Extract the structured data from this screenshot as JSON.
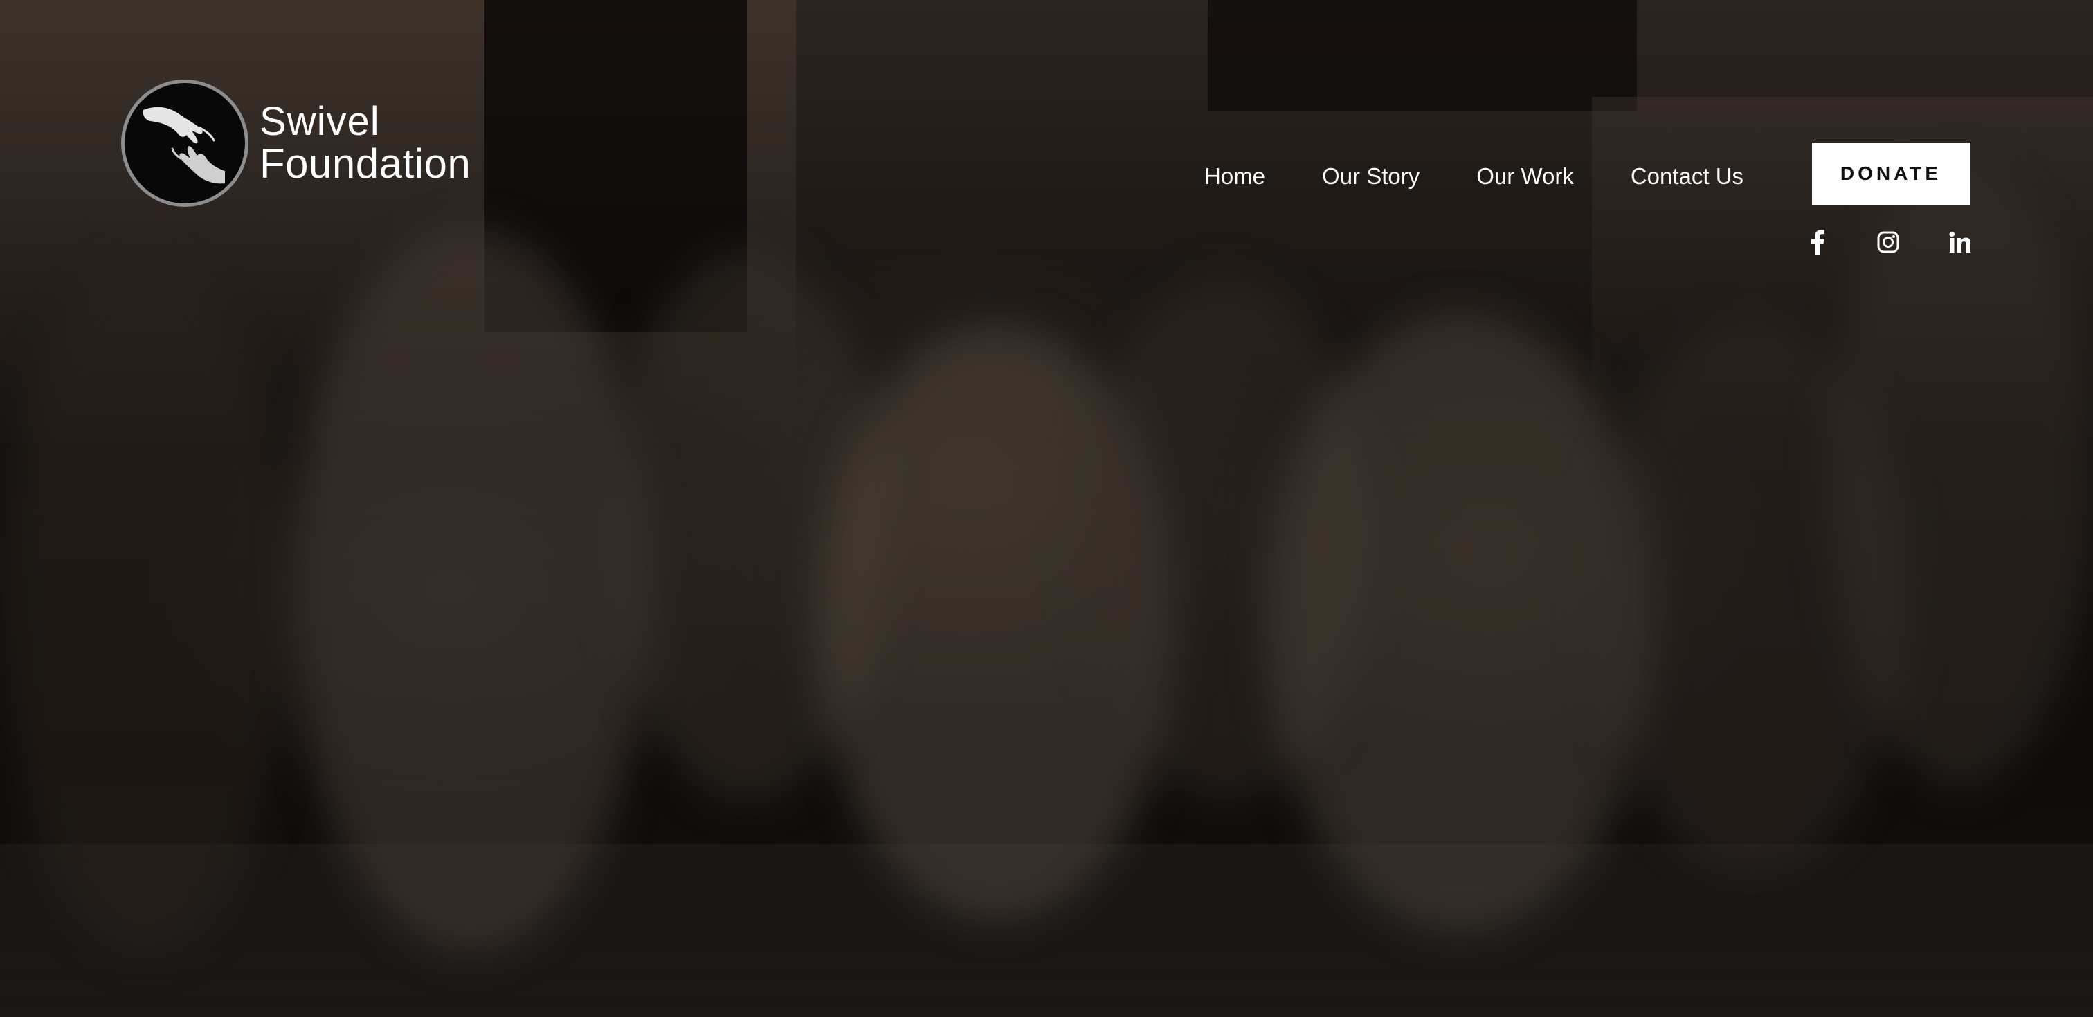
{
  "brand": {
    "name_line1": "Swivel",
    "name_line2": "Foundation",
    "logo_icon": "reaching-hands-icon"
  },
  "nav": {
    "items": [
      {
        "label": "Home"
      },
      {
        "label": "Our Story"
      },
      {
        "label": "Our Work"
      },
      {
        "label": "Contact Us"
      }
    ]
  },
  "cta": {
    "donate_label": "DONATE"
  },
  "social": {
    "icons": [
      "facebook-icon",
      "instagram-icon",
      "linkedin-icon"
    ]
  },
  "hero": {
    "background": "dimmed photo of children seated on the floor"
  },
  "colors": {
    "text": "#ffffff",
    "button_bg": "#ffffff",
    "button_text": "#111111",
    "overlay": "#0e0b09"
  }
}
